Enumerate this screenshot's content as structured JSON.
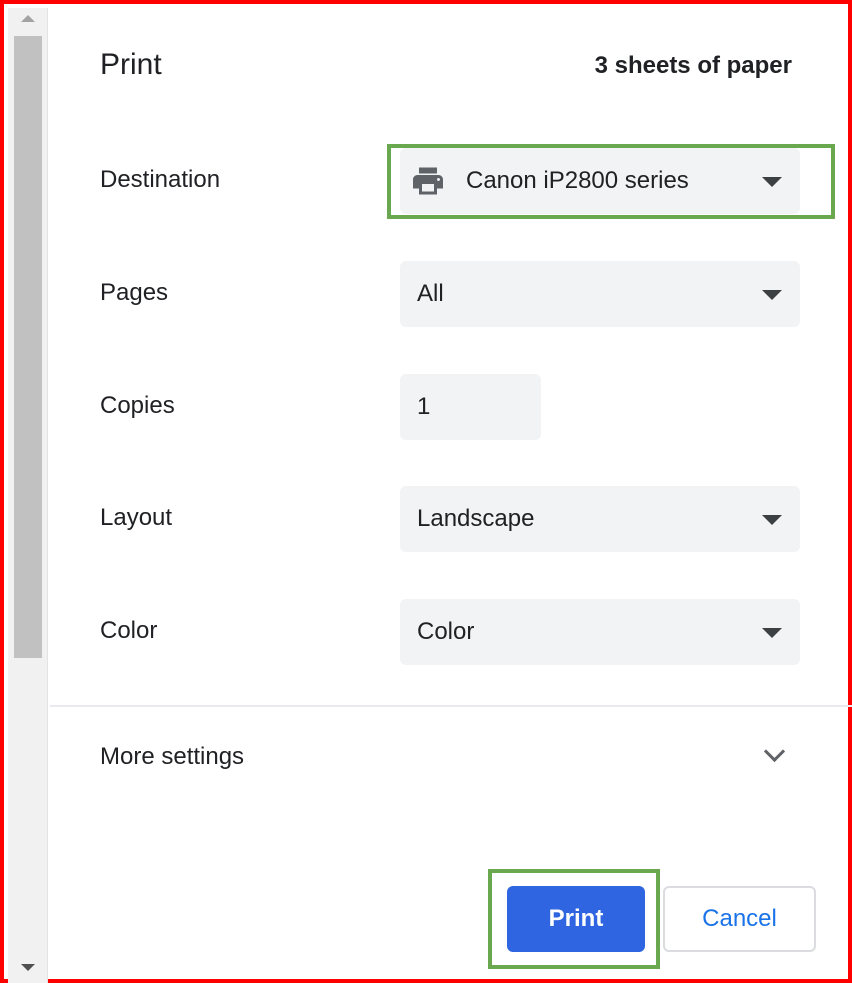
{
  "header": {
    "title": "Print",
    "sheets": "3 sheets of paper"
  },
  "destination": {
    "label": "Destination",
    "value": "Canon iP2800 series",
    "icon": "printer-icon"
  },
  "pages": {
    "label": "Pages",
    "value": "All"
  },
  "copies": {
    "label": "Copies",
    "value": "1"
  },
  "layout": {
    "label": "Layout",
    "value": "Landscape"
  },
  "color": {
    "label": "Color",
    "value": "Color"
  },
  "more_settings": {
    "label": "More settings",
    "icon": "chevron-down-icon"
  },
  "buttons": {
    "print": "Print",
    "cancel": "Cancel"
  },
  "colors": {
    "frame_border": "#ff0000",
    "highlight_border": "#6aa84f",
    "primary_button": "#2f65e0",
    "cancel_text": "#1a73e8",
    "field_background": "#f1f3f4"
  }
}
